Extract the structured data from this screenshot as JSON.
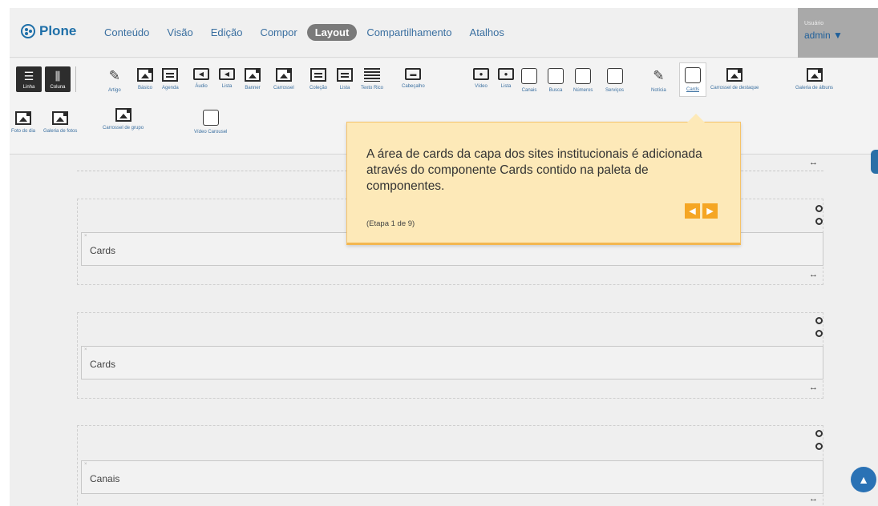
{
  "app": {
    "brand": "Plone"
  },
  "menu": [
    "Conteúdo",
    "Visão",
    "Edição",
    "Compor",
    "Layout",
    "Compartilhamento",
    "Atalhos"
  ],
  "active_menu": "Layout",
  "user": {
    "label": "Usuário",
    "name": "admin ▼"
  },
  "palette": {
    "layout_tools": [
      {
        "label": "Linha",
        "icon": "rows-icon"
      },
      {
        "label": "Coluna",
        "icon": "columns-icon"
      }
    ],
    "items_row1": [
      "Artigo",
      "Básico",
      "Agenda",
      "Áudio",
      "Lista",
      "Banner",
      "Carrossel",
      "Coleção",
      "Lista",
      "Texto Rico",
      "Cabeçalho",
      "Vídeo",
      "Lista",
      "Canais",
      "Busca",
      "Números",
      "Serviços",
      "Notícia",
      "Cards",
      "Carrossel de destaque",
      "Galeria de álbuns"
    ],
    "items_row2": [
      "Foto do dia",
      "Galeria de fotos",
      "Carrossel de grupo",
      "Vídeo Carousel"
    ],
    "selected": "Cards"
  },
  "blocks": [
    {
      "title": "Cards"
    },
    {
      "title": "Cards"
    },
    {
      "title": "Canais"
    }
  ],
  "tooltip": {
    "text": "A área de cards da capa dos sites institucionais é adicionada através do componente Cards contido na paleta de componentes.",
    "step": "(Etapa 1 de 9)",
    "prev": "◀",
    "next": "▶"
  },
  "colors": {
    "accent": "#1e6fa8",
    "tooltip_bg": "#fde9b8",
    "tooltip_btn": "#f5a623"
  }
}
